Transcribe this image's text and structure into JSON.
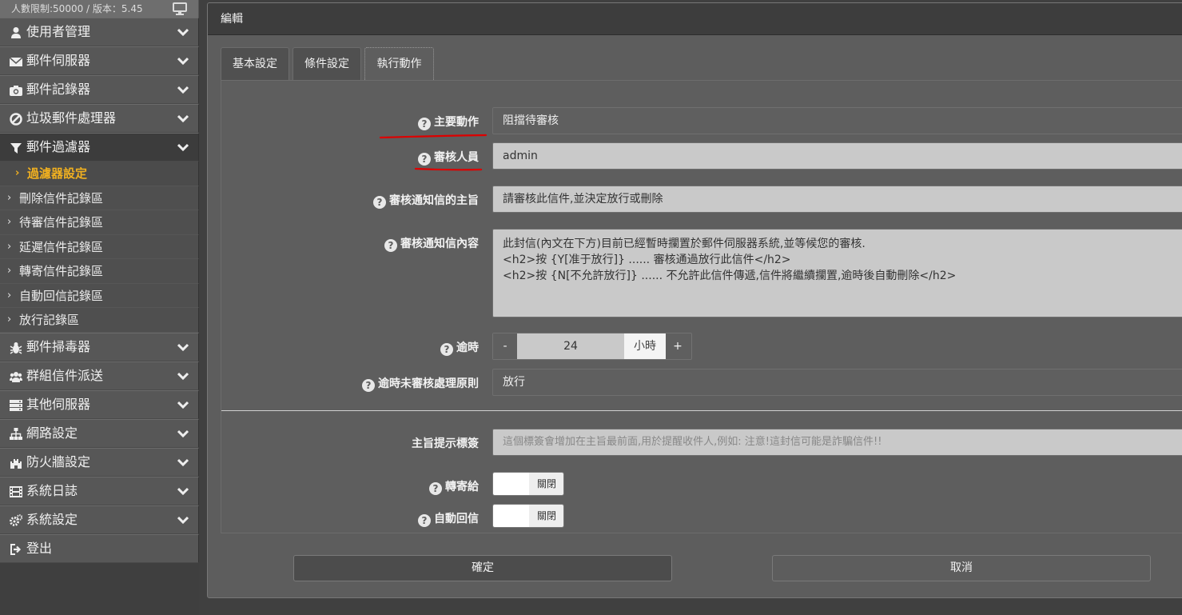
{
  "sidebar": {
    "top_info": "人數限制:50000 / 版本：5.45",
    "menu_top": [
      {
        "label": "使用者管理",
        "icon": "user-icon"
      },
      {
        "label": "郵件伺服器",
        "icon": "envelope-icon"
      },
      {
        "label": "郵件記錄器",
        "icon": "camera-icon"
      },
      {
        "label": "垃圾郵件處理器",
        "icon": "ban-icon"
      },
      {
        "label": "郵件過濾器",
        "icon": "filter-icon"
      }
    ],
    "submenu": [
      {
        "label": "過濾器設定"
      },
      {
        "label": "刪除信件記錄區"
      },
      {
        "label": "待審信件記錄區"
      },
      {
        "label": "延遲信件記錄區"
      },
      {
        "label": "轉寄信件記錄區"
      },
      {
        "label": "自動回信記錄區"
      },
      {
        "label": "放行記錄區"
      }
    ],
    "menu_bottom": [
      {
        "label": "郵件掃毒器",
        "icon": "bug-icon"
      },
      {
        "label": "群組信件派送",
        "icon": "users-icon"
      },
      {
        "label": "其他伺服器",
        "icon": "server-icon"
      },
      {
        "label": "網路設定",
        "icon": "sitemap-icon"
      },
      {
        "label": "防火牆設定",
        "icon": "castle-icon"
      },
      {
        "label": "系統日誌",
        "icon": "film-icon"
      },
      {
        "label": "系統設定",
        "icon": "cogs-icon"
      },
      {
        "label": "登出",
        "icon": "sign-out-icon"
      }
    ]
  },
  "modal": {
    "title": "編輯",
    "tabs": [
      {
        "label": "基本設定"
      },
      {
        "label": "條件設定"
      },
      {
        "label": "執行動作"
      }
    ],
    "form": {
      "main_action_label": "主要動作",
      "main_action_value": "阻擋待審核",
      "reviewer_label": "審核人員",
      "reviewer_value": "admin",
      "notify_subject_label": "審核通知信的主旨",
      "notify_subject_value": "請審核此信件,並決定放行或刪除",
      "notify_body_label": "審核通知信內容",
      "notify_body_lines": [
        "此封信(內文在下方)目前已經暫時攔置於郵件伺服器系統,並等候您的審核.",
        "<h2>按 {Y[准于放行]} ...... 審核通過放行此信件</h2>",
        "<h2>按 {N[不允許放行]} ...... 不允許此信件傳遞,信件將繼續攔置,逾時後自動刪除</h2>"
      ],
      "timeout_label": "逾時",
      "timeout_minus": "-",
      "timeout_value": "24",
      "timeout_unit": "小時",
      "timeout_plus": "+",
      "timeout_policy_label": "逾時未審核處理原則",
      "timeout_policy_value": "放行",
      "subject_tag_label": "主旨提示標簽",
      "subject_tag_placeholder": "這個標簽會增加在主旨最前面,用於提醒收件人,例如: 注意!這封信可能是詐騙信件!!",
      "forward_label": "轉寄給",
      "forward_toggle": "關閉",
      "auto_reply_label": "自動回信",
      "auto_reply_toggle": "關閉"
    },
    "confirm_label": "確定",
    "cancel_label": "取消"
  },
  "colors": {
    "accent": "#f0b020",
    "annotation": "#dd0000"
  }
}
